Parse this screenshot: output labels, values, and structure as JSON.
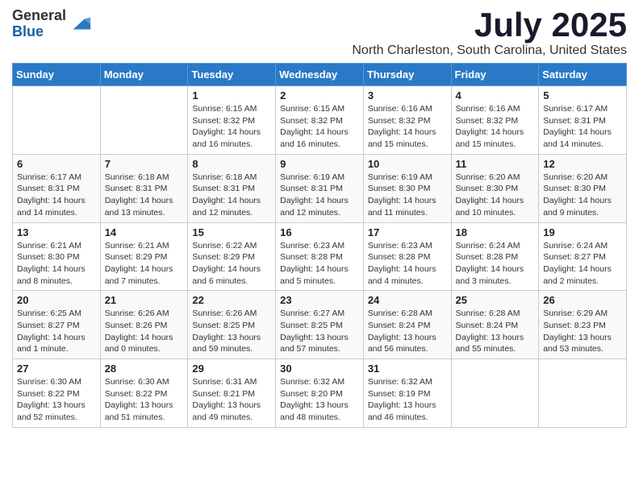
{
  "logo": {
    "general": "General",
    "blue": "Blue"
  },
  "title": "July 2025",
  "location": "North Charleston, South Carolina, United States",
  "weekdays": [
    "Sunday",
    "Monday",
    "Tuesday",
    "Wednesday",
    "Thursday",
    "Friday",
    "Saturday"
  ],
  "weeks": [
    [
      {
        "day": "",
        "info": ""
      },
      {
        "day": "",
        "info": ""
      },
      {
        "day": "1",
        "info": "Sunrise: 6:15 AM\nSunset: 8:32 PM\nDaylight: 14 hours and 16 minutes."
      },
      {
        "day": "2",
        "info": "Sunrise: 6:15 AM\nSunset: 8:32 PM\nDaylight: 14 hours and 16 minutes."
      },
      {
        "day": "3",
        "info": "Sunrise: 6:16 AM\nSunset: 8:32 PM\nDaylight: 14 hours and 15 minutes."
      },
      {
        "day": "4",
        "info": "Sunrise: 6:16 AM\nSunset: 8:32 PM\nDaylight: 14 hours and 15 minutes."
      },
      {
        "day": "5",
        "info": "Sunrise: 6:17 AM\nSunset: 8:31 PM\nDaylight: 14 hours and 14 minutes."
      }
    ],
    [
      {
        "day": "6",
        "info": "Sunrise: 6:17 AM\nSunset: 8:31 PM\nDaylight: 14 hours and 14 minutes."
      },
      {
        "day": "7",
        "info": "Sunrise: 6:18 AM\nSunset: 8:31 PM\nDaylight: 14 hours and 13 minutes."
      },
      {
        "day": "8",
        "info": "Sunrise: 6:18 AM\nSunset: 8:31 PM\nDaylight: 14 hours and 12 minutes."
      },
      {
        "day": "9",
        "info": "Sunrise: 6:19 AM\nSunset: 8:31 PM\nDaylight: 14 hours and 12 minutes."
      },
      {
        "day": "10",
        "info": "Sunrise: 6:19 AM\nSunset: 8:30 PM\nDaylight: 14 hours and 11 minutes."
      },
      {
        "day": "11",
        "info": "Sunrise: 6:20 AM\nSunset: 8:30 PM\nDaylight: 14 hours and 10 minutes."
      },
      {
        "day": "12",
        "info": "Sunrise: 6:20 AM\nSunset: 8:30 PM\nDaylight: 14 hours and 9 minutes."
      }
    ],
    [
      {
        "day": "13",
        "info": "Sunrise: 6:21 AM\nSunset: 8:30 PM\nDaylight: 14 hours and 8 minutes."
      },
      {
        "day": "14",
        "info": "Sunrise: 6:21 AM\nSunset: 8:29 PM\nDaylight: 14 hours and 7 minutes."
      },
      {
        "day": "15",
        "info": "Sunrise: 6:22 AM\nSunset: 8:29 PM\nDaylight: 14 hours and 6 minutes."
      },
      {
        "day": "16",
        "info": "Sunrise: 6:23 AM\nSunset: 8:28 PM\nDaylight: 14 hours and 5 minutes."
      },
      {
        "day": "17",
        "info": "Sunrise: 6:23 AM\nSunset: 8:28 PM\nDaylight: 14 hours and 4 minutes."
      },
      {
        "day": "18",
        "info": "Sunrise: 6:24 AM\nSunset: 8:28 PM\nDaylight: 14 hours and 3 minutes."
      },
      {
        "day": "19",
        "info": "Sunrise: 6:24 AM\nSunset: 8:27 PM\nDaylight: 14 hours and 2 minutes."
      }
    ],
    [
      {
        "day": "20",
        "info": "Sunrise: 6:25 AM\nSunset: 8:27 PM\nDaylight: 14 hours and 1 minute."
      },
      {
        "day": "21",
        "info": "Sunrise: 6:26 AM\nSunset: 8:26 PM\nDaylight: 14 hours and 0 minutes."
      },
      {
        "day": "22",
        "info": "Sunrise: 6:26 AM\nSunset: 8:25 PM\nDaylight: 13 hours and 59 minutes."
      },
      {
        "day": "23",
        "info": "Sunrise: 6:27 AM\nSunset: 8:25 PM\nDaylight: 13 hours and 57 minutes."
      },
      {
        "day": "24",
        "info": "Sunrise: 6:28 AM\nSunset: 8:24 PM\nDaylight: 13 hours and 56 minutes."
      },
      {
        "day": "25",
        "info": "Sunrise: 6:28 AM\nSunset: 8:24 PM\nDaylight: 13 hours and 55 minutes."
      },
      {
        "day": "26",
        "info": "Sunrise: 6:29 AM\nSunset: 8:23 PM\nDaylight: 13 hours and 53 minutes."
      }
    ],
    [
      {
        "day": "27",
        "info": "Sunrise: 6:30 AM\nSunset: 8:22 PM\nDaylight: 13 hours and 52 minutes."
      },
      {
        "day": "28",
        "info": "Sunrise: 6:30 AM\nSunset: 8:22 PM\nDaylight: 13 hours and 51 minutes."
      },
      {
        "day": "29",
        "info": "Sunrise: 6:31 AM\nSunset: 8:21 PM\nDaylight: 13 hours and 49 minutes."
      },
      {
        "day": "30",
        "info": "Sunrise: 6:32 AM\nSunset: 8:20 PM\nDaylight: 13 hours and 48 minutes."
      },
      {
        "day": "31",
        "info": "Sunrise: 6:32 AM\nSunset: 8:19 PM\nDaylight: 13 hours and 46 minutes."
      },
      {
        "day": "",
        "info": ""
      },
      {
        "day": "",
        "info": ""
      }
    ]
  ]
}
